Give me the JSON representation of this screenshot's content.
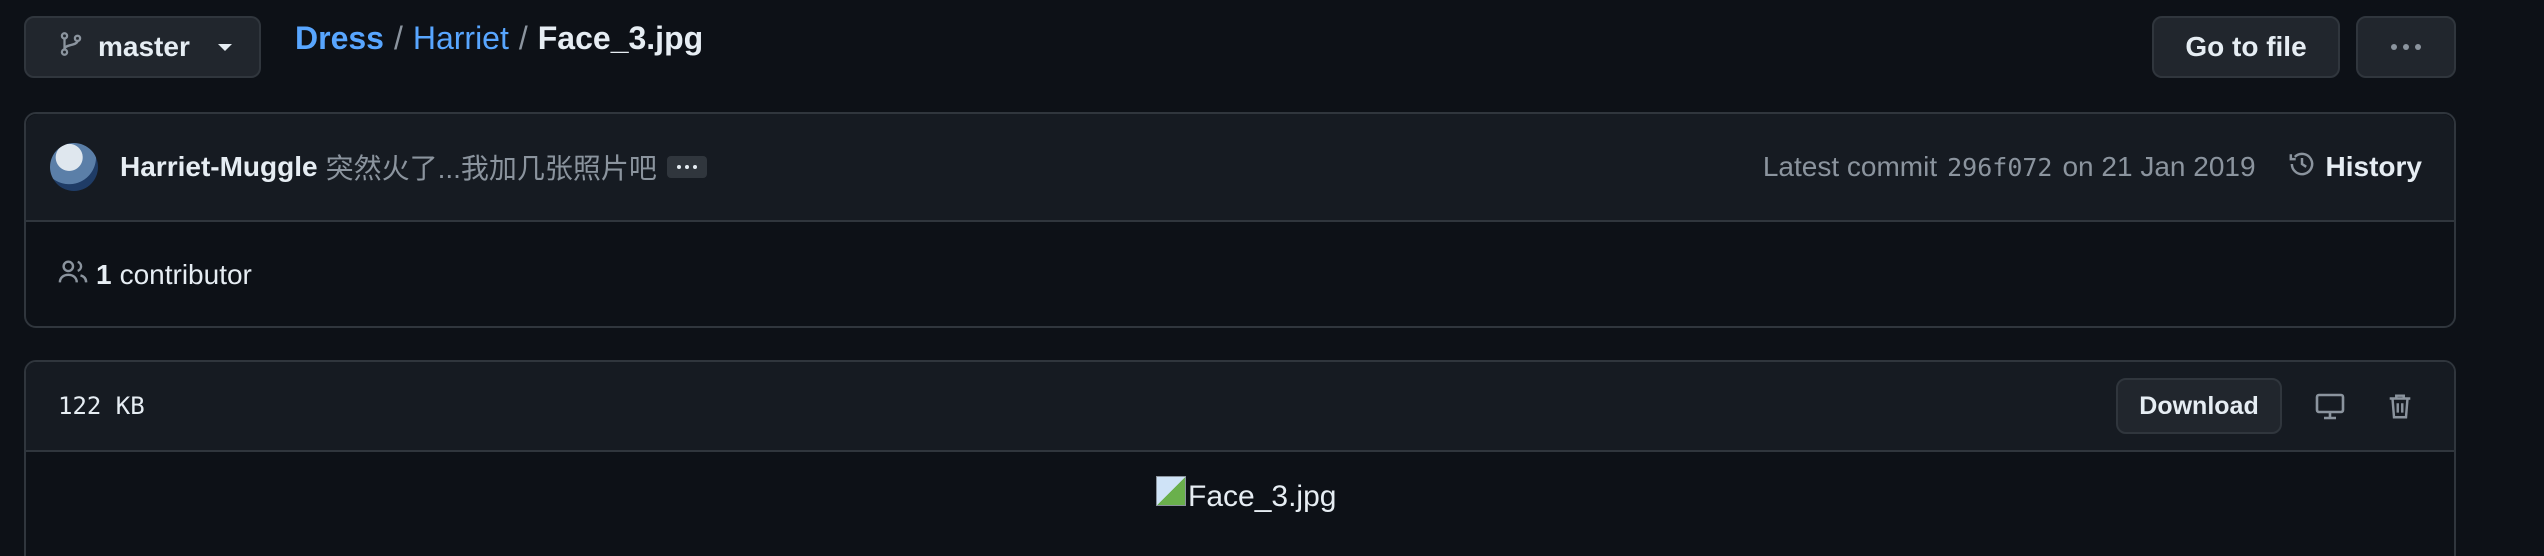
{
  "branch": {
    "label": "master",
    "icon": "git-branch-icon"
  },
  "breadcrumb": {
    "repo": "Dress",
    "folder": "Harriet",
    "file": "Face_3.jpg",
    "separator": "/"
  },
  "actions": {
    "goto_file": "Go to file",
    "more_icon": "kebab-horizontal-icon"
  },
  "commit": {
    "author": "Harriet-Muggle",
    "message": "突然火了...我加几张照片吧",
    "latest_label": "Latest commit",
    "sha": "296f072",
    "date_text": "on 21 Jan 2019",
    "history_label": "History"
  },
  "contributors": {
    "count": "1",
    "label": "contributor"
  },
  "file": {
    "size": "122 KB",
    "download_label": "Download",
    "image_alt": "Face_3.jpg"
  },
  "colors": {
    "background": "#0d1117",
    "border": "#30363d",
    "link": "#58a6ff",
    "muted": "#8b949e"
  }
}
